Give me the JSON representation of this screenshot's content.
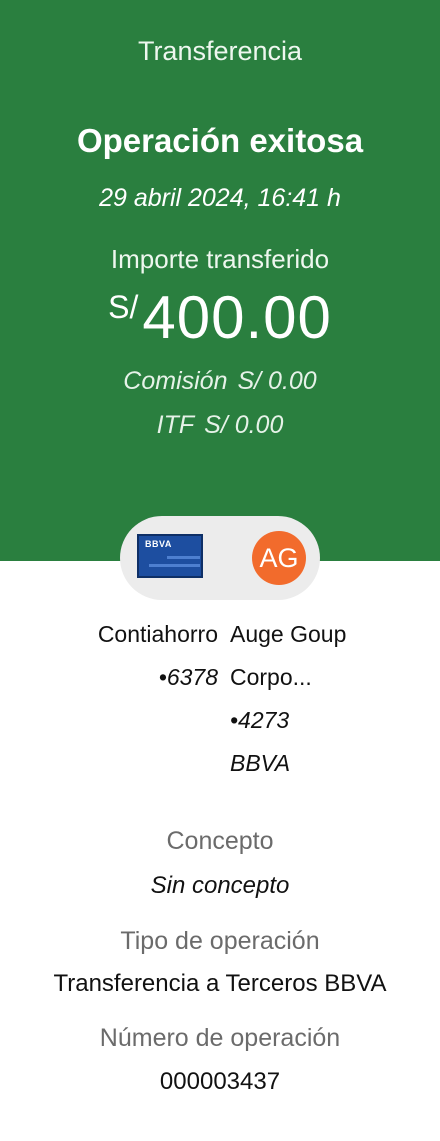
{
  "header": {
    "title": "Transferencia",
    "status": "Operación exitosa",
    "datetime": "29 abril 2024, 16:41 h",
    "amount_label": "Importe transferido",
    "currency": "S/",
    "amount": "400.00",
    "commission_label": "Comisión",
    "commission_value": "S/ 0.00",
    "itf_label": "ITF",
    "itf_value": "S/ 0.00"
  },
  "colors": {
    "header_bg": "#2a7f3f",
    "avatar_bg": "#f26b2c",
    "card_bg": "#1d4ea0"
  },
  "icons": {
    "source": "bbva-card-icon",
    "destination": "avatar-initials"
  },
  "origin": {
    "card_brand": "BBVA",
    "account_name": "Contiahorro",
    "account_suffix": "•6378"
  },
  "destination": {
    "initials": "AG",
    "name_line1": "Auge Goup",
    "name_line2": "Corpo...",
    "account_suffix": "•4273",
    "bank": "BBVA"
  },
  "details": {
    "concept_label": "Concepto",
    "concept_value": "Sin concepto",
    "type_label": "Tipo de operación",
    "type_value": "Transferencia a Terceros BBVA",
    "number_label": "Número de operación",
    "number_value": "000003437"
  }
}
